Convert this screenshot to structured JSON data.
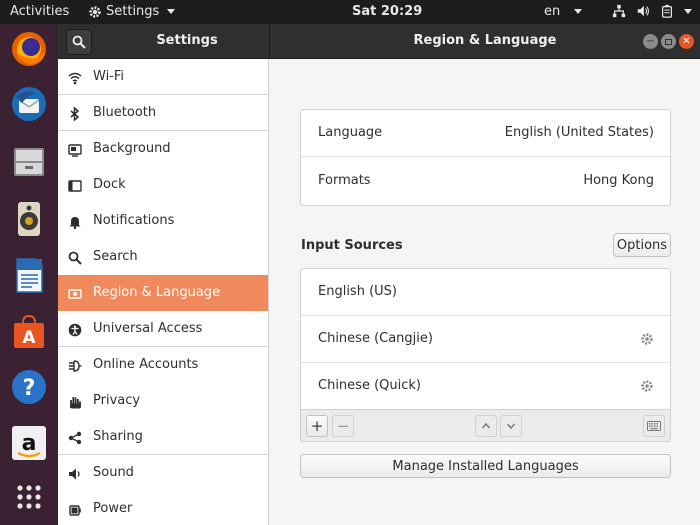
{
  "topbar": {
    "activities": "Activities",
    "app_name": "Settings",
    "clock": "Sat 20:29",
    "language": "en"
  },
  "dock": {
    "items": [
      "firefox-icon",
      "thunderbird-icon",
      "files-icon",
      "rhythmbox-icon",
      "writer-icon",
      "software-icon",
      "help-icon",
      "amazon-icon",
      "show-apps-icon"
    ]
  },
  "window": {
    "sidebar_title": "Settings",
    "title": "Region & Language"
  },
  "sidebar": {
    "items": [
      {
        "label": "Wi-Fi",
        "icon": "wifi-icon"
      },
      {
        "label": "Bluetooth",
        "icon": "bluetooth-icon"
      },
      {
        "label": "Background",
        "icon": "background-icon"
      },
      {
        "label": "Dock",
        "icon": "dock-icon"
      },
      {
        "label": "Notifications",
        "icon": "bell-icon"
      },
      {
        "label": "Search",
        "icon": "search-icon"
      },
      {
        "label": "Region & Language",
        "icon": "region-icon",
        "selected": true
      },
      {
        "label": "Universal Access",
        "icon": "universal-access-icon"
      },
      {
        "label": "Online Accounts",
        "icon": "online-accounts-icon"
      },
      {
        "label": "Privacy",
        "icon": "hand-icon"
      },
      {
        "label": "Sharing",
        "icon": "share-icon"
      },
      {
        "label": "Sound",
        "icon": "speaker-icon"
      },
      {
        "label": "Power",
        "icon": "power-icon"
      }
    ]
  },
  "region": {
    "language_label": "Language",
    "language_value": "English (United States)",
    "formats_label": "Formats",
    "formats_value": "Hong Kong"
  },
  "input_sources": {
    "title": "Input Sources",
    "options_label": "Options",
    "items": [
      {
        "label": "English (US)",
        "has_settings": false
      },
      {
        "label": "Chinese (Cangjie)",
        "has_settings": true
      },
      {
        "label": "Chinese (Quick)",
        "has_settings": true
      }
    ],
    "add_label": "+",
    "remove_label": "−"
  },
  "manage_label": "Manage Installed Languages",
  "colors": {
    "accent": "#e95420",
    "selected_row": "#f08a5d",
    "topbar": "#1d1d1d",
    "dock": "#3b2233",
    "headerbar": "#2f2f2f"
  }
}
